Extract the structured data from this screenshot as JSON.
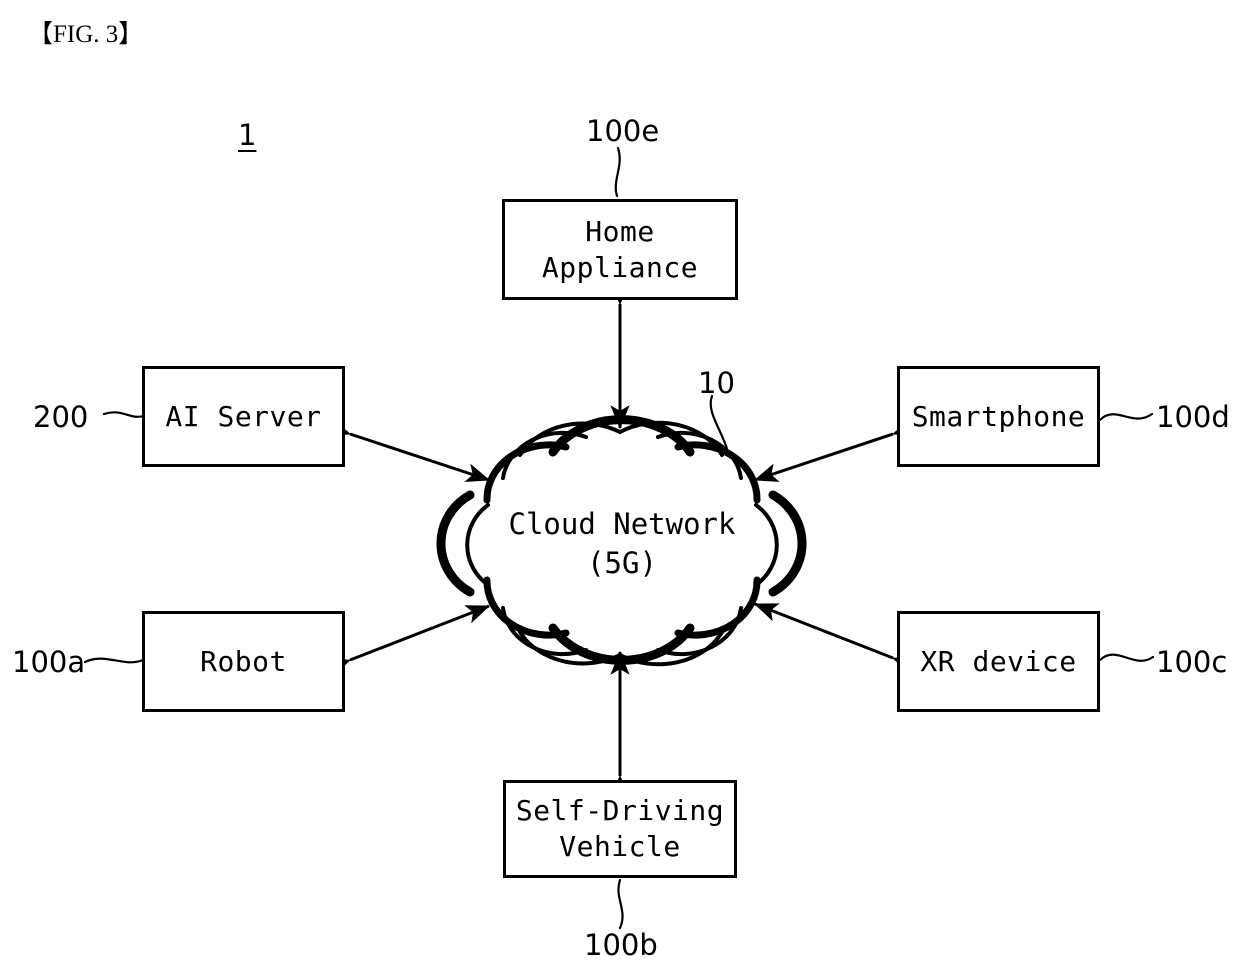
{
  "figure": {
    "label": "【FIG. 3】",
    "system_number": "1"
  },
  "cloud": {
    "name": "Cloud Network",
    "line1": "Cloud Network",
    "line2": "(5G)",
    "text": "Cloud Network\n(5G)",
    "ref": "10"
  },
  "nodes": [
    {
      "id": "home-appliance",
      "label": "Home\nAppliance",
      "ref": "100e",
      "ref_position": "top"
    },
    {
      "id": "ai-server",
      "label": "AI Server",
      "ref": "200",
      "ref_position": "left"
    },
    {
      "id": "smartphone",
      "label": "Smartphone",
      "ref": "100d",
      "ref_position": "right"
    },
    {
      "id": "robot",
      "label": "Robot",
      "ref": "100a",
      "ref_position": "left"
    },
    {
      "id": "xr-device",
      "label": "XR device",
      "ref": "100c",
      "ref_position": "right"
    },
    {
      "id": "self-driving-vehicle",
      "label": "Self-Driving\nVehicle",
      "ref": "100b",
      "ref_position": "bottom"
    }
  ],
  "connections": [
    {
      "from": "home-appliance",
      "to": "cloud",
      "style": "double-arrow"
    },
    {
      "from": "ai-server",
      "to": "cloud",
      "style": "double-arrow"
    },
    {
      "from": "smartphone",
      "to": "cloud",
      "style": "double-arrow"
    },
    {
      "from": "robot",
      "to": "cloud",
      "style": "double-arrow"
    },
    {
      "from": "xr-device",
      "to": "cloud",
      "style": "double-arrow"
    },
    {
      "from": "self-driving-vehicle",
      "to": "cloud",
      "style": "double-arrow"
    }
  ],
  "colors": {
    "ink": "#000000",
    "background": "#ffffff"
  }
}
